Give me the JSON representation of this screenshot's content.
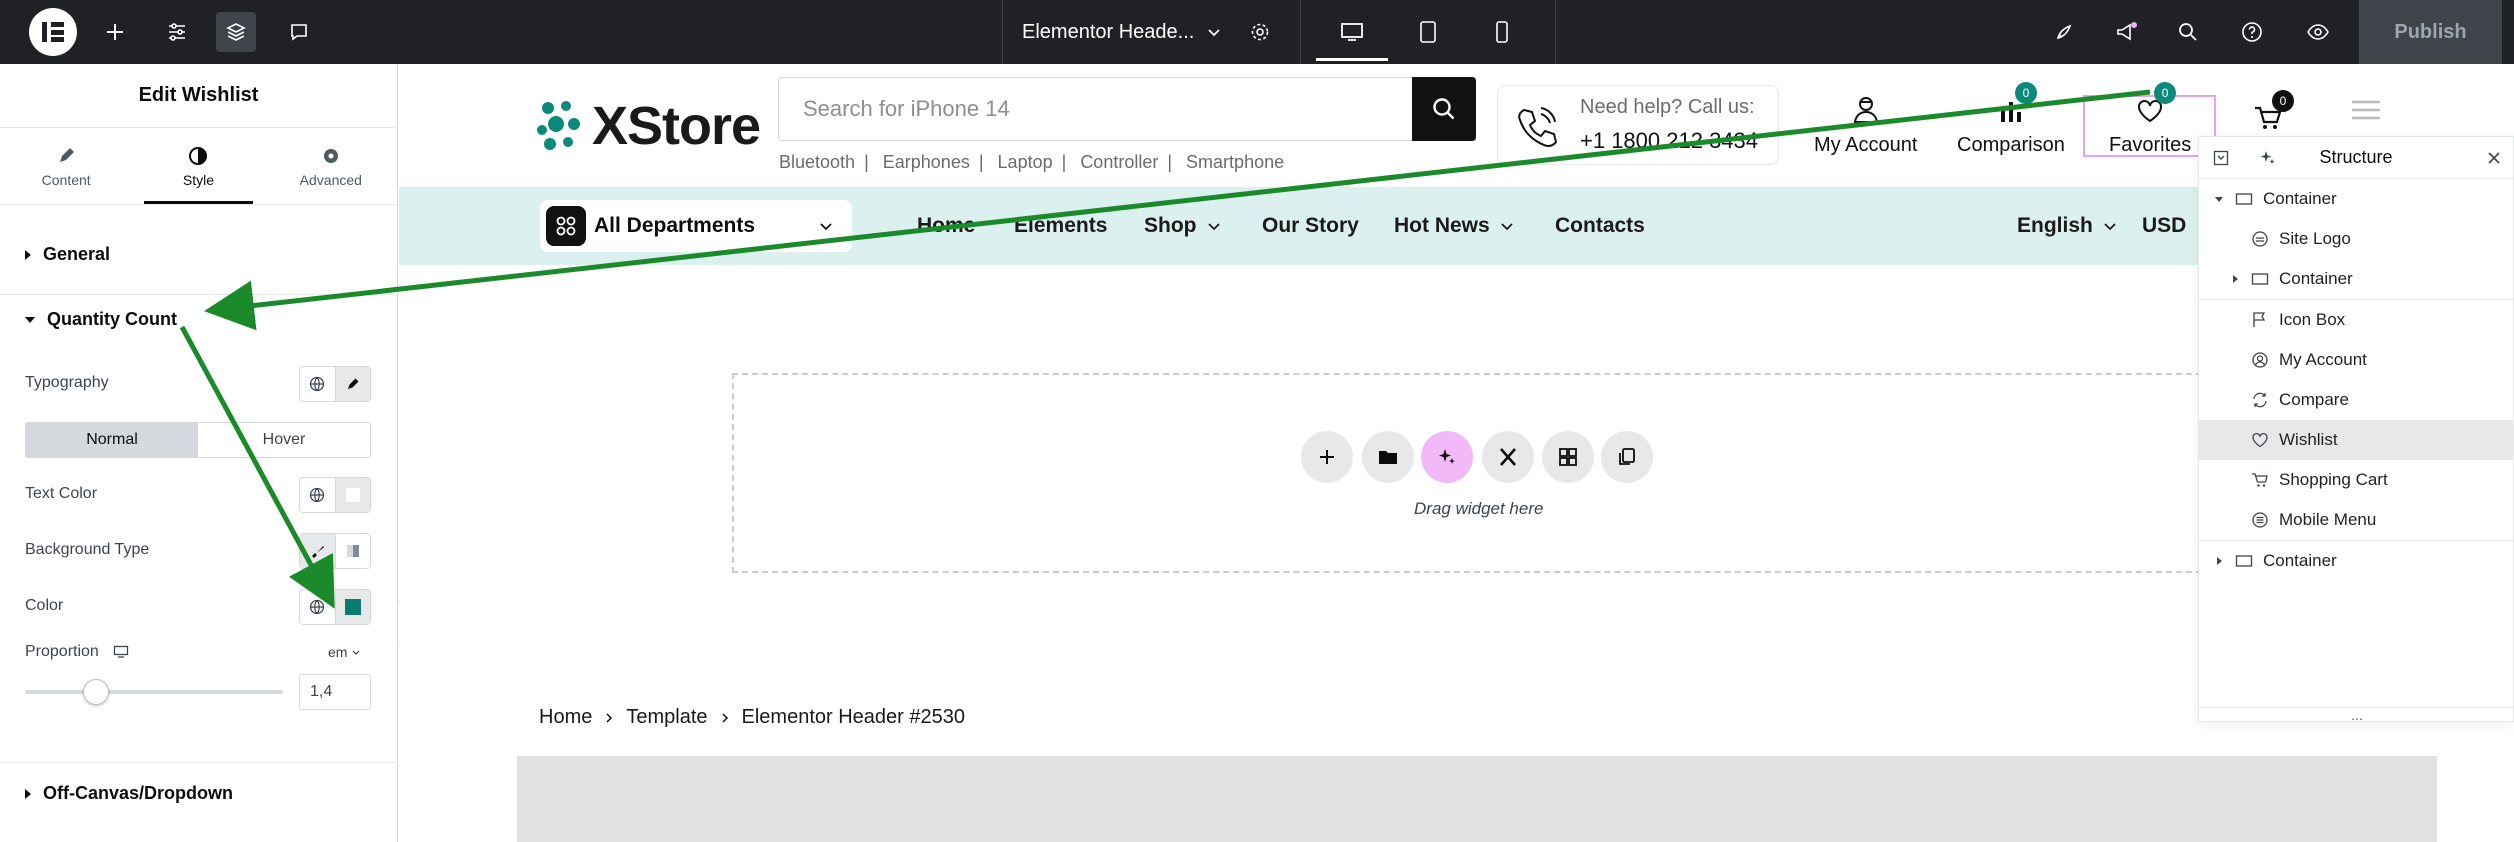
{
  "topbar": {
    "document_title": "Elementor Heade...",
    "publish_label": "Publish"
  },
  "panel": {
    "title": "Edit Wishlist",
    "tabs": [
      {
        "label": "Content",
        "icon": "pencil-icon"
      },
      {
        "label": "Style",
        "icon": "half-circle-icon"
      },
      {
        "label": "Advanced",
        "icon": "gear-icon"
      }
    ],
    "sections": {
      "general": "General",
      "quantity_count": "Quantity Count",
      "off_canvas": "Off-Canvas/Dropdown"
    },
    "controls": {
      "typography": "Typography",
      "state_normal": "Normal",
      "state_hover": "Hover",
      "text_color": "Text Color",
      "background_type": "Background Type",
      "color": "Color",
      "color_value": "#0b7a6e",
      "text_color_value": "#ffffff",
      "proportion": "Proportion",
      "proportion_unit": "em",
      "proportion_value": "1,4"
    }
  },
  "site": {
    "logo_text": "XStore",
    "search_placeholder": "Search for iPhone 14",
    "search_tags": [
      "Bluetooth",
      "Earphones",
      "Laptop",
      "Controller",
      "Smartphone"
    ],
    "help_title": "Need help? Call us:",
    "help_phone": "+1 1800 212 3434",
    "header_items": {
      "account": "My Account",
      "comparison": "Comparison",
      "comparison_count": "0",
      "favorites": "Favorites",
      "favorites_count": "0",
      "cart_count": "0"
    },
    "departments_label": "All Departments",
    "menu": [
      "Home",
      "Elements",
      "Shop",
      "Our Story",
      "Hot News",
      "Contacts"
    ],
    "language": "English",
    "currency": "USD",
    "dropzone_text": "Drag widget here",
    "breadcrumbs": [
      "Home",
      "Template",
      "Elementor Header #2530"
    ],
    "accent_color": "#0b8a7c",
    "nav_background": "#dcf0ef"
  },
  "structure": {
    "title": "Structure",
    "items": [
      {
        "label": "Container",
        "icon": "container-icon"
      },
      {
        "label": "Site Logo",
        "icon": "site-logo-icon"
      },
      {
        "label": "Container",
        "icon": "container-icon"
      },
      {
        "label": "Icon Box",
        "icon": "flag-icon"
      },
      {
        "label": "My Account",
        "icon": "account-icon"
      },
      {
        "label": "Compare",
        "icon": "compare-icon"
      },
      {
        "label": "Wishlist",
        "icon": "heart-icon"
      },
      {
        "label": "Shopping Cart",
        "icon": "cart-icon"
      },
      {
        "label": "Mobile Menu",
        "icon": "menu-icon"
      },
      {
        "label": "Container",
        "icon": "container-icon"
      }
    ],
    "more": "..."
  }
}
